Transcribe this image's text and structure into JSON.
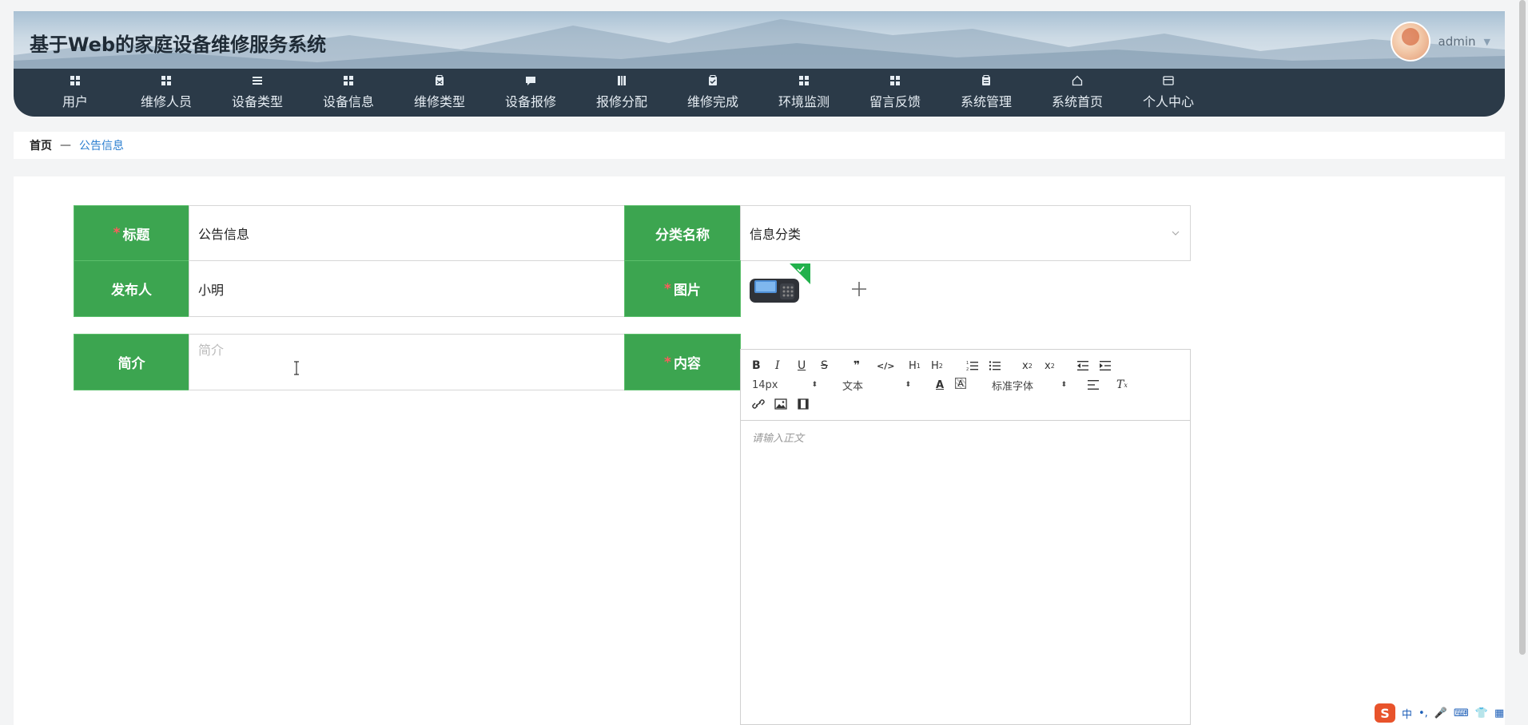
{
  "header": {
    "site_title": "基于Web的家庭设备维修服务系统",
    "user_name": "admin"
  },
  "nav": [
    {
      "label": "用户",
      "icon": "grid-icon"
    },
    {
      "label": "维修人员",
      "icon": "grid-icon"
    },
    {
      "label": "设备类型",
      "icon": "list-icon"
    },
    {
      "label": "设备信息",
      "icon": "grid-icon"
    },
    {
      "label": "维修类型",
      "icon": "clipboard-icon"
    },
    {
      "label": "设备报修",
      "icon": "chat-icon"
    },
    {
      "label": "报修分配",
      "icon": "book-icon"
    },
    {
      "label": "维修完成",
      "icon": "clipboard-check-icon"
    },
    {
      "label": "环境监测",
      "icon": "grid-icon"
    },
    {
      "label": "留言反馈",
      "icon": "grid-icon"
    },
    {
      "label": "系统管理",
      "icon": "clipboard-icon"
    },
    {
      "label": "系统首页",
      "icon": "home-icon"
    },
    {
      "label": "个人中心",
      "icon": "card-icon"
    }
  ],
  "breadcrumb": {
    "home": "首页",
    "separator": "—",
    "current": "公告信息"
  },
  "form": {
    "title_label": "标题",
    "title_value": "公告信息",
    "category_label": "分类名称",
    "category_value": "信息分类",
    "publisher_label": "发布人",
    "publisher_value": "小明",
    "image_label": "图片",
    "intro_label": "简介",
    "intro_placeholder": "简介",
    "content_label": "内容",
    "required_mark": "*"
  },
  "editor": {
    "font_size": "14px",
    "text_style": "文本",
    "font_family": "标准字体",
    "placeholder": "请输入正文"
  },
  "tray": {
    "ime_mode": "中",
    "punct": "•,"
  },
  "colors": {
    "label_green": "#3ca550",
    "nav_bg": "#2b3a48",
    "link_blue": "#2c7fd0"
  }
}
